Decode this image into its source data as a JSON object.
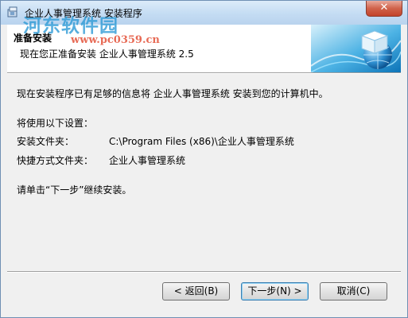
{
  "window": {
    "title": "企业人事管理系统 安装程序",
    "close_symbol": "✕"
  },
  "watermark": {
    "text": "河东软件园",
    "url": "www.pc0359.cn"
  },
  "header": {
    "title": "准备安装",
    "subtitle": "现在您正准备安装 企业人事管理系统 2.5"
  },
  "body": {
    "intro": "现在安装程序已有足够的信息将 企业人事管理系统 安装到您的计算机中。",
    "settings_heading": "将使用以下设置：",
    "install_folder_label": "安装文件夹：",
    "install_folder_value": "C:\\Program Files (x86)\\企业人事管理系统",
    "shortcut_folder_label": "快捷方式文件夹：",
    "shortcut_folder_value": "企业人事管理系统",
    "continue_text": "请单击“下一步”继续安装。"
  },
  "buttons": {
    "back": "< 返回(B)",
    "next": "下一步(N) >",
    "cancel": "取消(C)"
  },
  "icons": {
    "app": "installer-box-icon",
    "logo": "globe-cube-icon"
  }
}
